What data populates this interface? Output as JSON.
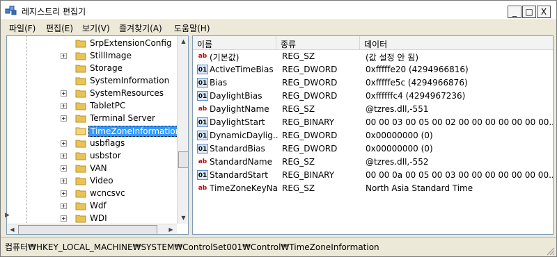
{
  "window": {
    "title": "레지스트리 편집기",
    "controls": {
      "minimize": "_",
      "maximize": "□",
      "close": "X"
    }
  },
  "menu": {
    "items": [
      {
        "label": "파일(F)"
      },
      {
        "label": "편집(E)"
      },
      {
        "label": "보기(V)"
      },
      {
        "label": "즐겨찾기(A)"
      },
      {
        "label": "도움말(H)"
      }
    ]
  },
  "tree": {
    "items": [
      {
        "label": "SrpExtensionConfig",
        "expandable": false,
        "selected": false
      },
      {
        "label": "StillImage",
        "expandable": true,
        "selected": false
      },
      {
        "label": "Storage",
        "expandable": false,
        "selected": false
      },
      {
        "label": "SystemInformation",
        "expandable": false,
        "selected": false
      },
      {
        "label": "SystemResources",
        "expandable": true,
        "selected": false
      },
      {
        "label": "TabletPC",
        "expandable": true,
        "selected": false
      },
      {
        "label": "Terminal Server",
        "expandable": true,
        "selected": false
      },
      {
        "label": "TimeZoneInformation",
        "expandable": false,
        "selected": true
      },
      {
        "label": "usbflags",
        "expandable": true,
        "selected": false
      },
      {
        "label": "usbstor",
        "expandable": true,
        "selected": false
      },
      {
        "label": "VAN",
        "expandable": true,
        "selected": false
      },
      {
        "label": "Video",
        "expandable": true,
        "selected": false
      },
      {
        "label": "wcncsvc",
        "expandable": true,
        "selected": false
      },
      {
        "label": "Wdf",
        "expandable": true,
        "selected": false
      },
      {
        "label": "WDI",
        "expandable": true,
        "selected": false
      }
    ],
    "expander_glyph": "+"
  },
  "values": {
    "headers": {
      "name": "이름",
      "type": "종류",
      "data": "데이터"
    },
    "rows": [
      {
        "icon": "string-value-icon",
        "icon_text": "ab",
        "name": "(기본값)",
        "type": "REG_SZ",
        "data": "(값 설정 안 됨)"
      },
      {
        "icon": "binary-value-icon",
        "icon_text": "01",
        "name": "ActiveTimeBias",
        "type": "REG_DWORD",
        "data": "0xfffffe20 (4294966816)"
      },
      {
        "icon": "binary-value-icon",
        "icon_text": "01",
        "name": "Bias",
        "type": "REG_DWORD",
        "data": "0xfffffe5c (4294966876)"
      },
      {
        "icon": "binary-value-icon",
        "icon_text": "01",
        "name": "DaylightBias",
        "type": "REG_DWORD",
        "data": "0xffffffc4 (4294967236)"
      },
      {
        "icon": "string-value-icon",
        "icon_text": "ab",
        "name": "DaylightName",
        "type": "REG_SZ",
        "data": "@tzres.dll,-551"
      },
      {
        "icon": "binary-value-icon",
        "icon_text": "01",
        "name": "DaylightStart",
        "type": "REG_BINARY",
        "data": "00 00 03 00 05 00 02 00 00 00 00 00 00 00..."
      },
      {
        "icon": "binary-value-icon",
        "icon_text": "01",
        "name": "DynamicDaylig...",
        "type": "REG_DWORD",
        "data": "0x00000000 (0)"
      },
      {
        "icon": "binary-value-icon",
        "icon_text": "01",
        "name": "StandardBias",
        "type": "REG_DWORD",
        "data": "0x00000000 (0)"
      },
      {
        "icon": "string-value-icon",
        "icon_text": "ab",
        "name": "StandardName",
        "type": "REG_SZ",
        "data": "@tzres.dll,-552"
      },
      {
        "icon": "binary-value-icon",
        "icon_text": "01",
        "name": "StandardStart",
        "type": "REG_BINARY",
        "data": "00 00 0a 00 05 00 03 00 00 00 00 00 00 00..."
      },
      {
        "icon": "string-value-icon",
        "icon_text": "ab",
        "name": "TimeZoneKeyNa...",
        "type": "REG_SZ",
        "data": "North Asia Standard Time"
      }
    ]
  },
  "status": {
    "path": "컴퓨터₩HKEY_LOCAL_MACHINE₩SYSTEM₩ControlSet001₩Control₩TimeZoneInformation"
  },
  "scroll": {
    "up": "▲",
    "down": "▼",
    "left": "◀",
    "right": "▶"
  },
  "colors": {
    "selection": "#3399ff",
    "folder": "#e8c458",
    "string_icon": "#c00000"
  }
}
